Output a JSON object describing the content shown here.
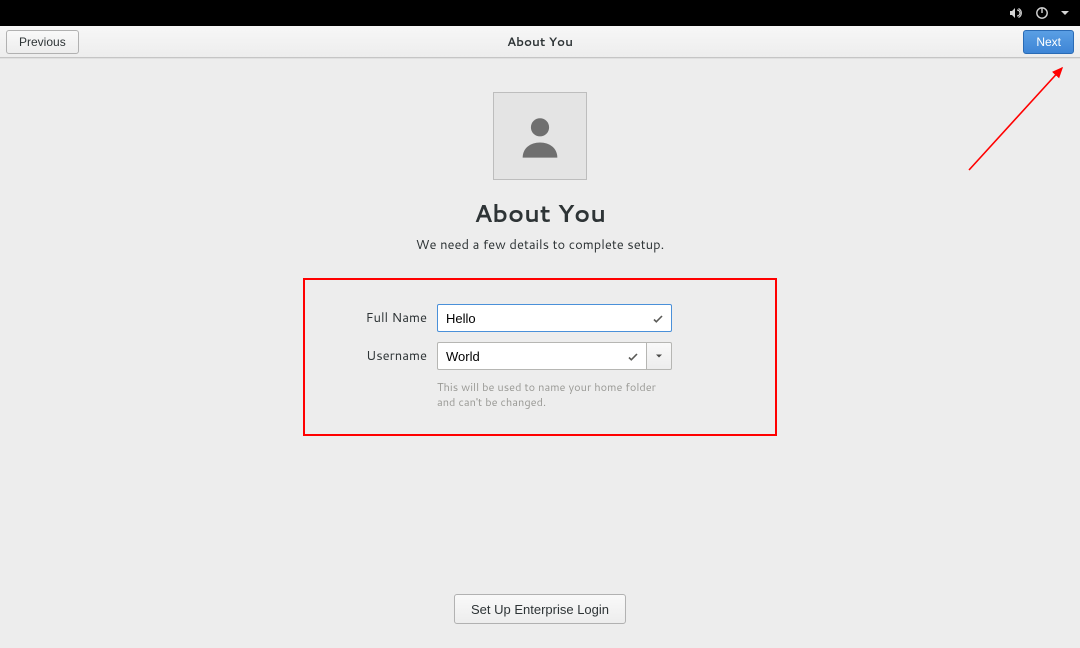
{
  "header": {
    "title": "About You",
    "previous_label": "Previous",
    "next_label": "Next"
  },
  "page": {
    "title": "About You",
    "subtitle": "We need a few details to complete setup."
  },
  "form": {
    "full_name_label": "Full Name",
    "full_name_value": "Hello",
    "username_label": "Username",
    "username_value": "World",
    "username_hint": "This will be used to name your home folder and can't be changed."
  },
  "footer": {
    "enterprise_label": "Set Up Enterprise Login"
  },
  "colors": {
    "accent": "#4a90d9",
    "annotation": "#ff0000"
  }
}
